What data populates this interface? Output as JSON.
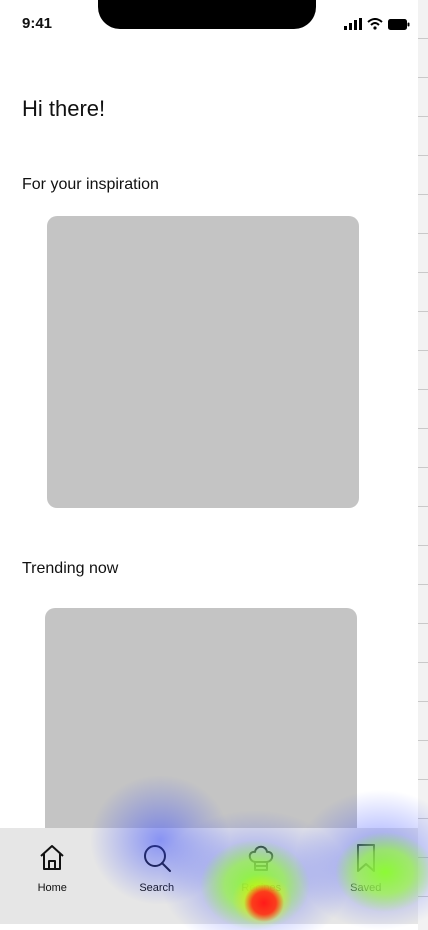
{
  "status_bar": {
    "time": "9:41"
  },
  "greeting": "Hi there!",
  "sections": [
    {
      "title": "For your inspiration"
    },
    {
      "title": "Trending now"
    }
  ],
  "tab_bar": {
    "items": [
      {
        "label": "Home",
        "icon": "home-icon"
      },
      {
        "label": "Search",
        "icon": "search-icon"
      },
      {
        "label": "Recipes",
        "icon": "chef-hat-icon"
      },
      {
        "label": "Saved",
        "icon": "bookmark-icon"
      }
    ]
  },
  "colors": {
    "placeholder": "#c4c4c4",
    "tab_bar": "#e6e6e6"
  }
}
